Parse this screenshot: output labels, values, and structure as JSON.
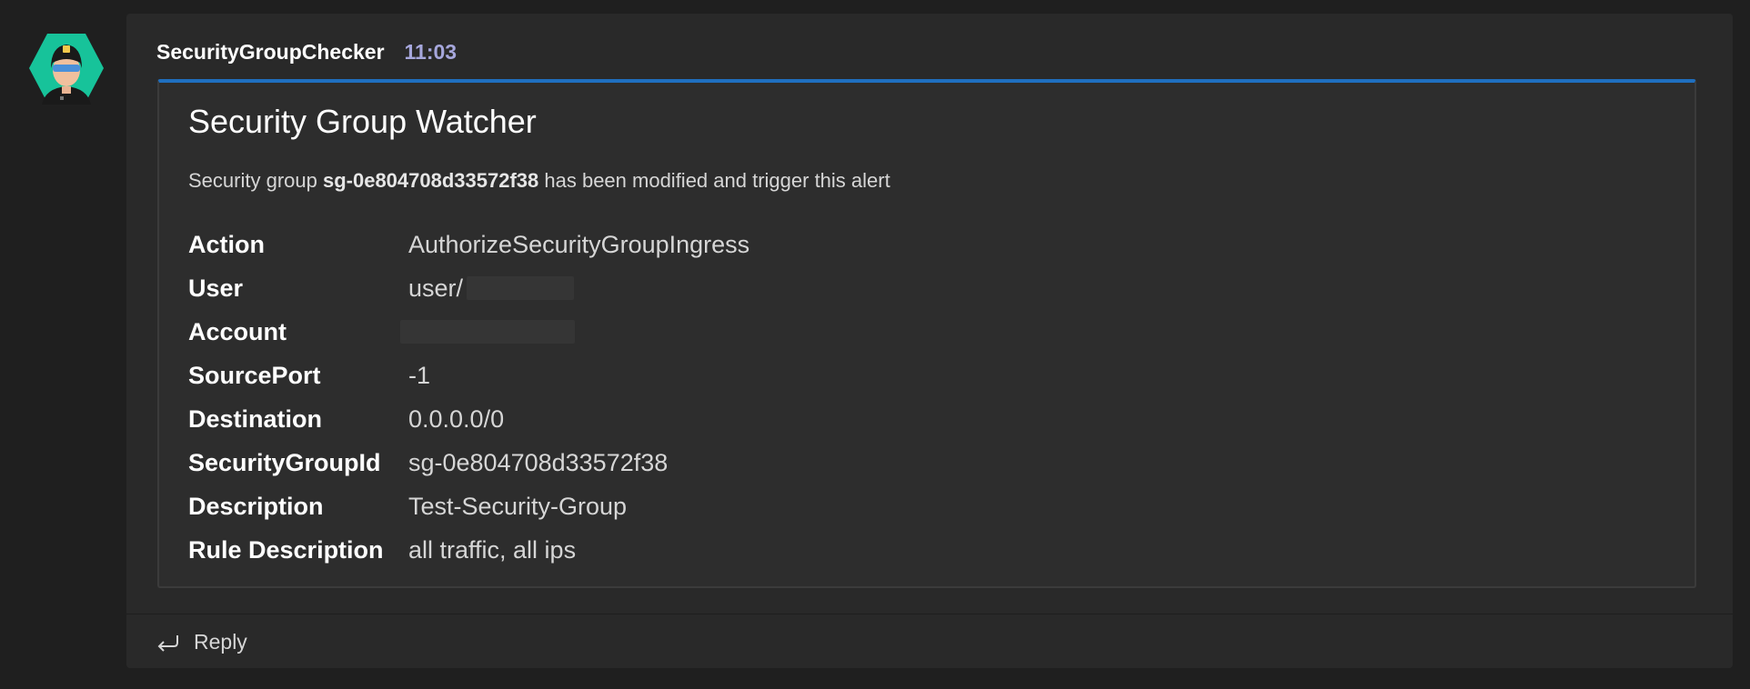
{
  "message": {
    "sender": "SecurityGroupChecker",
    "time": "11:03"
  },
  "card": {
    "title": "Security Group Watcher",
    "description": {
      "prefix": "Security group ",
      "group_id": "sg-0e804708d33572f38",
      "suffix": " has been modified and trigger this alert"
    },
    "facts": [
      {
        "key": "Action",
        "value": "AuthorizeSecurityGroupIngress"
      },
      {
        "key": "User",
        "value": "user/"
      },
      {
        "key": "Account",
        "value": ""
      },
      {
        "key": "SourcePort",
        "value": "-1"
      },
      {
        "key": "Destination",
        "value": "0.0.0.0/0"
      },
      {
        "key": "SecurityGroupId",
        "value": "sg-0e804708d33572f38"
      },
      {
        "key": "Description",
        "value": "Test-Security-Group"
      },
      {
        "key": "Rule Description",
        "value": "all traffic, all ips"
      }
    ],
    "accent_color": "#1f6fbf"
  },
  "footer": {
    "reply_label": "Reply"
  },
  "icons": {
    "avatar": "security-officer-avatar-icon",
    "reply": "reply-arrow-icon"
  }
}
